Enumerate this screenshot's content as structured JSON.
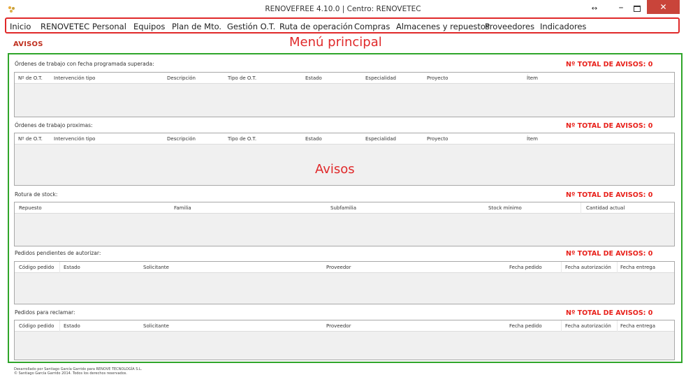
{
  "window": {
    "title": "RENOVEFREE 4.10.0 | Centro: RENOVETEC",
    "resize_glyph": "↔",
    "minimize_glyph": "–",
    "close_glyph": "✕"
  },
  "menu": {
    "items": [
      "Inicio",
      "RENOVETEC",
      "Personal",
      "Equipos",
      "Plan de Mto.",
      "Gestión O.T.",
      "Ruta de operación",
      "Compras",
      "Almacenes y repuestos",
      "Proveedores",
      "Indicadores"
    ],
    "annotation": "Menú principal"
  },
  "page": {
    "title": "AVISOS",
    "annotation": "Avisos"
  },
  "sections": [
    {
      "label": "Órdenes de trabajo con fecha programada superada:",
      "total_label": "Nº TOTAL DE AVISOS:",
      "total_value": "0",
      "columns": [
        "Nº de O.T.",
        "Intervención tipo",
        "Descripción",
        "Tipo de O.T.",
        "Estado",
        "Especialidad",
        "Proyecto",
        "Ítem"
      ]
    },
    {
      "label": "Órdenes de trabajo proximas:",
      "total_label": "Nº TOTAL DE AVISOS:",
      "total_value": "0",
      "columns": [
        "Nº de O.T.",
        "Intervención tipo",
        "Descripción",
        "Tipo de O.T.",
        "Estado",
        "Especialidad",
        "Proyecto",
        "Ítem"
      ]
    },
    {
      "label": "Rotura de stock:",
      "total_label": "Nº TOTAL DE AVISOS:",
      "total_value": "0",
      "columns": [
        "Repuesto",
        "Familia",
        "Subfamilia",
        "Stock mínimo",
        "Cantidad actual"
      ]
    },
    {
      "label": "Pedidos pendientes de autorizar:",
      "total_label": "Nº TOTAL DE AVISOS:",
      "total_value": "0",
      "columns": [
        "Código pedido",
        "Estado",
        "Solicitante",
        "Proveedor",
        "Fecha pedido",
        "Fecha autorización",
        "Fecha entrega"
      ]
    },
    {
      "label": "Pedidos para reclamar:",
      "total_label": "Nº TOTAL DE AVISOS:",
      "total_value": "0",
      "columns": [
        "Código pedido",
        "Estado",
        "Solicitante",
        "Proveedor",
        "Fecha pedido",
        "Fecha autorización",
        "Fecha entrega"
      ]
    }
  ],
  "footer": {
    "line1": "Desarrollado por Santiago García Garrido para RENOVE TECNOLOGÍA S.L.",
    "line2": "© Santiago García Garrido 2014. Todos los derechos reservados."
  },
  "colors": {
    "menu_annotation": "#e0292a",
    "avisos_frame": "#2fa52a",
    "total": "#e8201a",
    "page_title": "#c0301f"
  }
}
